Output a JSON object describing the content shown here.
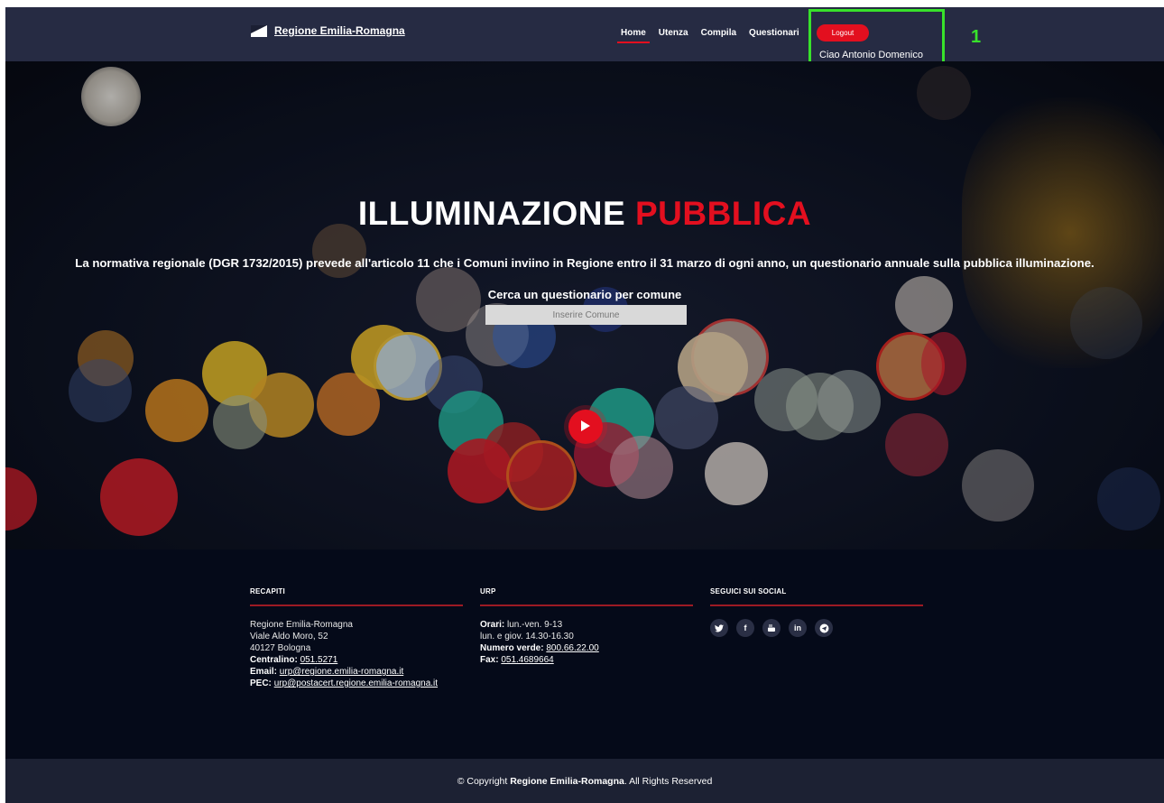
{
  "header": {
    "brand": "Regione Emilia-Romagna",
    "nav": [
      {
        "label": "Home",
        "active": true
      },
      {
        "label": "Utenza",
        "active": false
      },
      {
        "label": "Compila",
        "active": false
      },
      {
        "label": "Questionari",
        "active": false
      }
    ],
    "logout_label": "Logout",
    "greeting": "Ciao Antonio Domenico",
    "annotation": "1"
  },
  "hero": {
    "title_main": "ILLUMINAZIONE",
    "title_accent": "PUBBLICA",
    "subtitle": "La normativa regionale (DGR 1732/2015) prevede all'articolo 11 che i Comuni inviino in Regione entro il 31 marzo di ogni anno, un questionario annuale sulla pubblica illuminazione.",
    "search_label": "Cerca un questionario per comune",
    "search_placeholder": "Inserire Comune"
  },
  "footer": {
    "recapiti": {
      "heading": "RECAPITI",
      "line1": "Regione Emilia-Romagna",
      "line2": "Viale Aldo Moro, 52",
      "line3": "40127 Bologna",
      "centralino_label": "Centralino:",
      "centralino": "051.5271",
      "email_label": "Email:",
      "email": "urp@regione.emilia-romagna.it",
      "pec_label": "PEC:",
      "pec": "urp@postacert.regione.emilia-romagna.it"
    },
    "urp": {
      "heading": "URP",
      "orari_label": "Orari:",
      "orari": "lun.-ven. 9-13",
      "orari2": "lun. e giov. 14.30-16.30",
      "numero_label": "Numero verde:",
      "numero": "800.66.22.00",
      "fax_label": "Fax:",
      "fax": "051.4689664"
    },
    "social": {
      "heading": "SEGUICI SUI SOCIAL",
      "icons": [
        "twitter-icon",
        "facebook-icon",
        "youtube-icon",
        "linkedin-icon",
        "telegram-icon"
      ]
    },
    "copyright_prefix": "© Copyright",
    "copyright_brand": "Regione Emilia-Romagna",
    "copyright_suffix": ". All Rights Reserved"
  },
  "colors": {
    "accent": "#e30f1f",
    "navbar": "#262b43",
    "footer": "#050a19",
    "annotation": "#38e22b"
  }
}
